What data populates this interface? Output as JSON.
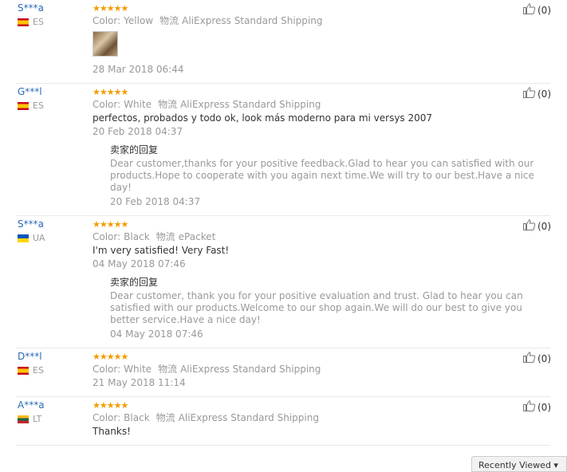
{
  "labels": {
    "color": "Color:",
    "shipping": "物流",
    "reply_title": "卖家的回复"
  },
  "reviews": [
    {
      "user": "S***a",
      "country": "ES",
      "rating": 5,
      "color": "Yellow",
      "shipping": "AliExpress Standard Shipping",
      "text": "",
      "has_photo": true,
      "date": "28 Mar 2018 06:44",
      "helpful": "(0)",
      "reply": null
    },
    {
      "user": "G***l",
      "country": "ES",
      "rating": 5,
      "color": "White",
      "shipping": "AliExpress Standard Shipping",
      "text": "perfectos, probados y todo ok, look más moderno para mi versys 2007",
      "has_photo": false,
      "date": "20 Feb 2018 04:37",
      "helpful": "(0)",
      "reply": {
        "text": "Dear customer,thanks for your positive feedback.Glad to hear you can satisfied with our products.Hope to cooperate with you again next time.We will try to our best.Have a nice day!",
        "date": "20 Feb 2018 04:37"
      }
    },
    {
      "user": "S***a",
      "country": "UA",
      "rating": 5,
      "color": "Black",
      "shipping": "ePacket",
      "text": "I'm very satisfied! Very Fast!",
      "has_photo": false,
      "date": "04 May 2018 07:46",
      "helpful": "(0)",
      "reply": {
        "text": "Dear customer, thank you for your positive evaluation and trust. Glad to hear you can satisfied with our products.Welcome to our shop again.We will do our best to give you better service.Have a nice day!",
        "date": "04 May 2018 07:46"
      }
    },
    {
      "user": "D***l",
      "country": "ES",
      "rating": 5,
      "color": "White",
      "shipping": "AliExpress Standard Shipping",
      "text": "",
      "has_photo": false,
      "date": "21 May 2018 11:14",
      "helpful": "(0)",
      "reply": null
    },
    {
      "user": "A***a",
      "country": "LT",
      "rating": 5,
      "color": "Black",
      "shipping": "AliExpress Standard Shipping",
      "text": "Thanks!",
      "has_photo": false,
      "date": "",
      "helpful": "(0)",
      "reply": null
    }
  ],
  "footer": {
    "sort_button": "Recently Viewed ▾"
  }
}
